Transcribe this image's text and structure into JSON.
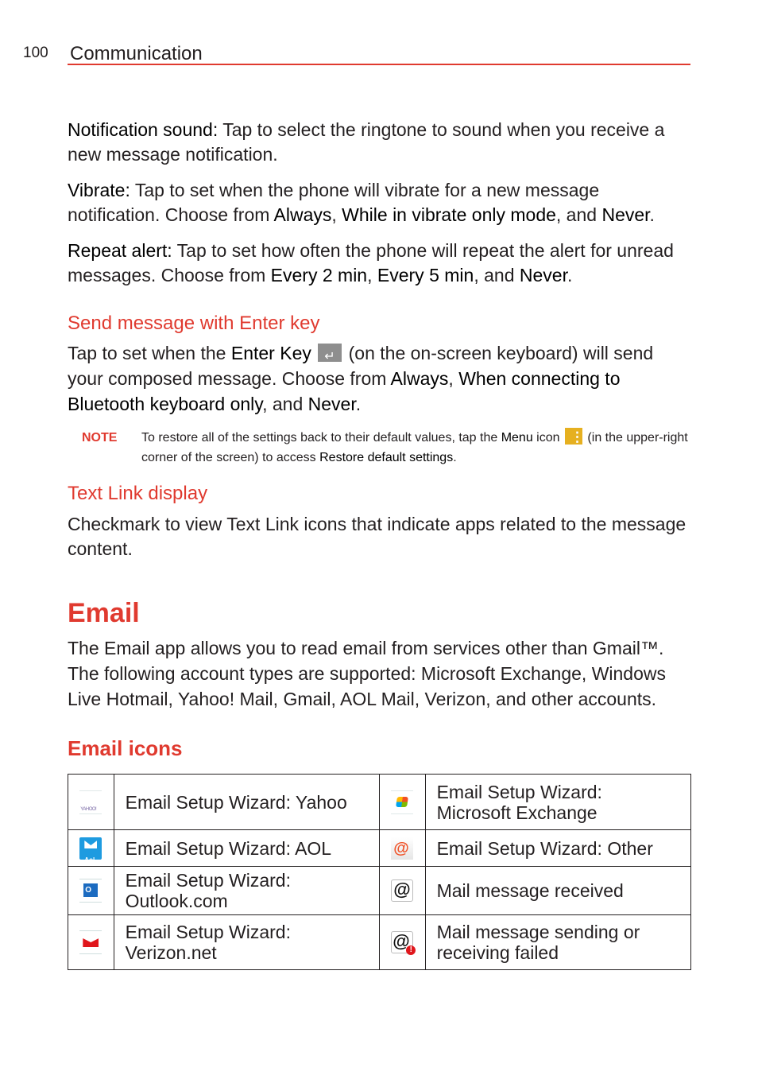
{
  "header": {
    "page_number": "100",
    "section": "Communication"
  },
  "settings": [
    {
      "term": "Notification sound:",
      "text": " Tap to select the ringtone to sound when you receive a new message notification."
    },
    {
      "term": "Vibrate:",
      "text_1": " Tap to set when the phone will vibrate for a new message notification. Choose from ",
      "opt_1": "Always",
      "sep_1": ", ",
      "opt_2": "While in vibrate only mode",
      "sep_2": ", and ",
      "opt_3": "Never",
      "end": "."
    },
    {
      "term": "Repeat alert:",
      "text_1": " Tap to set how often the phone will repeat the alert for unread messages. Choose from ",
      "opt_1": "Every 2 min",
      "sep_1": ", ",
      "opt_2": "Every 5 min",
      "sep_2": ", and ",
      "opt_3": "Never",
      "end": "."
    }
  ],
  "send_enter": {
    "heading": "Send message with Enter key",
    "text_1": "Tap to set when the ",
    "term": "Enter Key",
    "icon": "enter-key-icon",
    "text_2": " (on the on-screen keyboard) will send your composed message. Choose from ",
    "opt_1": "Always",
    "sep_1": ", ",
    "opt_2": "When connecting to Bluetooth keyboard only",
    "sep_2": ", and ",
    "opt_3": "Never",
    "end": "."
  },
  "note": {
    "label": "NOTE",
    "text_1": "To restore all of the settings back to their default values, tap the ",
    "menu": "Menu",
    "text_2": " icon ",
    "icon": "menu-icon",
    "text_3": " (in the upper-right corner of the screen) to access ",
    "restore": "Restore default settings",
    "end": "."
  },
  "text_link": {
    "heading": "Text Link display",
    "text": "Checkmark to view Text Link icons that indicate apps related to the message content."
  },
  "email": {
    "title": "Email",
    "intro": "The Email app allows you to read email from services other than Gmail™. The following account types are supported: Microsoft Exchange, Windows Live Hotmail, Yahoo! Mail, Gmail, AOL Mail, Verizon, and other accounts.",
    "icons_heading": "Email icons",
    "table": [
      [
        {
          "icon": "yahoo-icon",
          "label": "Email Setup Wizard: Yahoo"
        },
        {
          "icon": "microsoft-exchange-icon",
          "label": "Email Setup Wizard:  Microsoft Exchange"
        }
      ],
      [
        {
          "icon": "aol-icon",
          "label": "Email Setup Wizard: AOL"
        },
        {
          "icon": "other-email-icon",
          "label": "Email Setup Wizard:  Other"
        }
      ],
      [
        {
          "icon": "outlook-icon",
          "label": "Email Setup Wizard: Outlook.com"
        },
        {
          "icon": "mail-received-icon",
          "label": "Mail message received"
        }
      ],
      [
        {
          "icon": "verizon-icon",
          "label": "Email Setup Wizard: Verizon.net"
        },
        {
          "icon": "mail-failed-icon",
          "label": "Mail message sending or receiving failed"
        }
      ]
    ]
  },
  "colors": {
    "accent": "#e03a2f",
    "text": "#231f20",
    "menu_icon": "#e6b020",
    "enter_key_icon": "#8e8e8e"
  }
}
